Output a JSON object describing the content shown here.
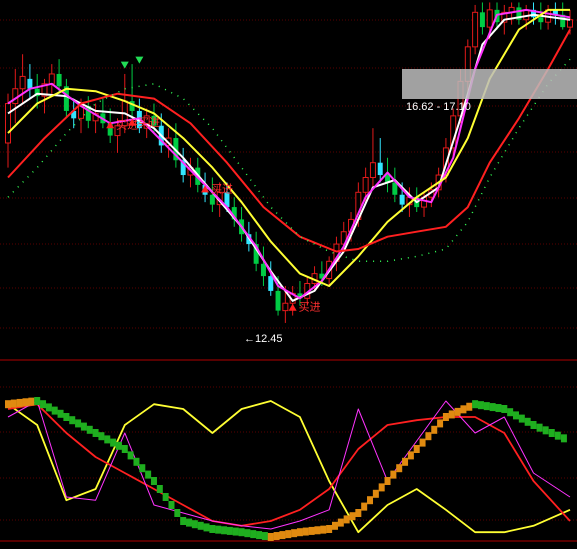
{
  "chart_data": [
    {
      "type": "candlestick",
      "panel": "price",
      "grid": true,
      "background": "#000000",
      "up_color": "#e31a1a",
      "down_color_strong": "#00cc44",
      "down_color_light": "#33e6ff",
      "ylim": [
        11.8,
        19.0
      ],
      "annotations": {
        "low_marker": "12.45",
        "range_box": "16.62 - 17.10",
        "signal_label": "买进"
      },
      "candles": [
        [
          16.1,
          17.1,
          15.6,
          16.9
        ],
        [
          16.9,
          17.6,
          16.5,
          17.2
        ],
        [
          17.2,
          17.9,
          16.9,
          17.45
        ],
        [
          17.4,
          17.7,
          17.0,
          17.2
        ],
        [
          17.2,
          17.5,
          16.8,
          17.05
        ],
        [
          17.05,
          17.4,
          16.7,
          17.3
        ],
        [
          17.3,
          17.7,
          17.1,
          17.5
        ],
        [
          17.5,
          17.8,
          17.1,
          17.25
        ],
        [
          17.25,
          17.4,
          16.6,
          16.75
        ],
        [
          16.75,
          17.0,
          16.4,
          16.6
        ],
        [
          16.6,
          17.0,
          16.3,
          16.85
        ],
        [
          16.85,
          17.05,
          16.4,
          16.55
        ],
        [
          16.55,
          16.9,
          16.3,
          16.7
        ],
        [
          16.7,
          17.0,
          16.4,
          16.5
        ],
        [
          16.5,
          16.8,
          16.1,
          16.25
        ],
        [
          16.25,
          16.6,
          15.9,
          16.45
        ],
        [
          16.45,
          17.5,
          16.3,
          16.95
        ],
        [
          16.95,
          17.7,
          16.6,
          16.75
        ],
        [
          16.75,
          17.0,
          16.3,
          16.4
        ],
        [
          16.4,
          16.8,
          16.2,
          16.65
        ],
        [
          16.65,
          16.9,
          16.3,
          16.45
        ],
        [
          16.45,
          16.7,
          15.9,
          16.05
        ],
        [
          16.05,
          16.4,
          15.8,
          16.2
        ],
        [
          16.2,
          16.5,
          15.6,
          15.75
        ],
        [
          15.75,
          16.0,
          15.3,
          15.45
        ],
        [
          15.45,
          15.8,
          15.2,
          15.6
        ],
        [
          15.6,
          15.8,
          15.1,
          15.25
        ],
        [
          15.25,
          15.5,
          14.9,
          15.05
        ],
        [
          15.05,
          15.4,
          14.7,
          14.85
        ],
        [
          14.85,
          15.3,
          14.6,
          15.1
        ],
        [
          15.1,
          15.3,
          14.7,
          14.8
        ],
        [
          14.8,
          15.0,
          14.4,
          14.55
        ],
        [
          14.55,
          14.8,
          14.1,
          14.25
        ],
        [
          14.25,
          14.5,
          13.9,
          14.05
        ],
        [
          14.05,
          14.3,
          13.5,
          13.65
        ],
        [
          13.65,
          14.0,
          13.2,
          13.4
        ],
        [
          13.4,
          13.7,
          13.0,
          13.1
        ],
        [
          13.1,
          13.4,
          12.6,
          12.7
        ],
        [
          12.7,
          13.2,
          12.45,
          12.85
        ],
        [
          12.85,
          13.2,
          12.6,
          13.05
        ],
        [
          13.05,
          13.3,
          12.8,
          12.95
        ],
        [
          12.95,
          13.4,
          12.8,
          13.25
        ],
        [
          13.25,
          13.6,
          13.1,
          13.45
        ],
        [
          13.45,
          13.7,
          13.2,
          13.35
        ],
        [
          13.35,
          13.8,
          13.2,
          13.7
        ],
        [
          13.7,
          14.2,
          13.5,
          14.05
        ],
        [
          14.05,
          14.5,
          13.9,
          14.3
        ],
        [
          14.3,
          14.7,
          14.1,
          14.55
        ],
        [
          14.55,
          15.3,
          14.4,
          15.1
        ],
        [
          15.1,
          15.6,
          14.9,
          15.4
        ],
        [
          15.4,
          16.4,
          15.2,
          15.7
        ],
        [
          15.7,
          16.2,
          15.3,
          15.45
        ],
        [
          15.45,
          15.8,
          15.1,
          15.3
        ],
        [
          15.3,
          15.6,
          14.9,
          15.05
        ],
        [
          15.05,
          15.3,
          14.7,
          14.85
        ],
        [
          14.85,
          15.2,
          14.6,
          15.0
        ],
        [
          15.0,
          15.2,
          14.7,
          14.8
        ],
        [
          14.8,
          15.1,
          14.6,
          15.0
        ],
        [
          15.0,
          15.3,
          14.8,
          15.15
        ],
        [
          15.15,
          15.6,
          15.0,
          15.45
        ],
        [
          15.45,
          16.2,
          15.3,
          16.0
        ],
        [
          16.0,
          16.8,
          15.8,
          16.65
        ],
        [
          16.65,
          17.6,
          16.5,
          17.35
        ],
        [
          17.35,
          18.2,
          17.1,
          18.05
        ],
        [
          18.05,
          18.9,
          17.9,
          18.75
        ],
        [
          18.75,
          18.95,
          18.3,
          18.45
        ],
        [
          18.45,
          18.95,
          18.2,
          18.8
        ],
        [
          18.8,
          18.95,
          18.4,
          18.55
        ],
        [
          18.55,
          18.9,
          18.3,
          18.75
        ],
        [
          18.75,
          18.95,
          18.5,
          18.85
        ],
        [
          18.85,
          18.95,
          18.5,
          18.6
        ],
        [
          18.6,
          18.9,
          18.4,
          18.8
        ],
        [
          18.8,
          18.95,
          18.5,
          18.65
        ],
        [
          18.65,
          18.95,
          18.4,
          18.55
        ],
        [
          18.55,
          18.9,
          18.4,
          18.8
        ],
        [
          18.8,
          18.95,
          18.5,
          18.7
        ],
        [
          18.7,
          18.95,
          18.4,
          18.45
        ],
        [
          18.45,
          18.8,
          18.3,
          18.6
        ]
      ],
      "series": [
        {
          "color": "#ffffff",
          "points": [
            [
              0,
              16.7
            ],
            [
              4,
              17.1
            ],
            [
              8,
              17.05
            ],
            [
              12,
              16.75
            ],
            [
              16,
              16.7
            ],
            [
              20,
              16.4
            ],
            [
              24,
              15.8
            ],
            [
              28,
              15.1
            ],
            [
              32,
              14.4
            ],
            [
              36,
              13.5
            ],
            [
              39,
              12.9
            ],
            [
              42,
              13.1
            ],
            [
              46,
              13.9
            ],
            [
              50,
              15.2
            ],
            [
              53,
              15.35
            ],
            [
              56,
              14.9
            ],
            [
              59,
              15.2
            ],
            [
              62,
              16.6
            ],
            [
              65,
              18.1
            ],
            [
              68,
              18.6
            ],
            [
              72,
              18.7
            ],
            [
              77,
              18.6
            ]
          ]
        },
        {
          "color": "#ff33ff",
          "points": [
            [
              0,
              16.9
            ],
            [
              3,
              17.2
            ],
            [
              6,
              17.3
            ],
            [
              10,
              16.85
            ],
            [
              14,
              16.5
            ],
            [
              18,
              16.6
            ],
            [
              22,
              16.0
            ],
            [
              26,
              15.4
            ],
            [
              30,
              14.8
            ],
            [
              34,
              14.0
            ],
            [
              37,
              13.2
            ],
            [
              40,
              12.95
            ],
            [
              43,
              13.3
            ],
            [
              46,
              14.0
            ],
            [
              49,
              15.0
            ],
            [
              52,
              15.5
            ],
            [
              55,
              15.0
            ],
            [
              58,
              14.9
            ],
            [
              61,
              15.8
            ],
            [
              64,
              17.6
            ],
            [
              67,
              18.7
            ],
            [
              71,
              18.8
            ],
            [
              77,
              18.65
            ]
          ]
        },
        {
          "color": "#ffff33",
          "points": [
            [
              0,
              16.3
            ],
            [
              4,
              16.9
            ],
            [
              8,
              17.2
            ],
            [
              12,
              17.15
            ],
            [
              16,
              16.95
            ],
            [
              20,
              16.7
            ],
            [
              24,
              16.2
            ],
            [
              28,
              15.6
            ],
            [
              32,
              14.9
            ],
            [
              36,
              14.1
            ],
            [
              40,
              13.45
            ],
            [
              44,
              13.2
            ],
            [
              48,
              13.8
            ],
            [
              52,
              14.5
            ],
            [
              56,
              15.0
            ],
            [
              60,
              15.4
            ],
            [
              63,
              16.2
            ],
            [
              66,
              17.4
            ],
            [
              70,
              18.4
            ],
            [
              74,
              18.8
            ],
            [
              77,
              18.8
            ]
          ]
        },
        {
          "color": "#ff2020",
          "points": [
            [
              0,
              15.4
            ],
            [
              5,
              16.2
            ],
            [
              10,
              16.9
            ],
            [
              15,
              17.1
            ],
            [
              20,
              17.0
            ],
            [
              25,
              16.5
            ],
            [
              30,
              15.7
            ],
            [
              35,
              14.8
            ],
            [
              40,
              14.2
            ],
            [
              45,
              13.9
            ],
            [
              48,
              13.95
            ],
            [
              52,
              14.2
            ],
            [
              56,
              14.3
            ],
            [
              60,
              14.4
            ],
            [
              63,
              14.8
            ],
            [
              66,
              15.7
            ],
            [
              70,
              16.6
            ],
            [
              74,
              17.6
            ],
            [
              77,
              18.4
            ]
          ]
        },
        {
          "color": "#33ff55",
          "dotted": true,
          "points": [
            [
              0,
              15.0
            ],
            [
              4,
              15.6
            ],
            [
              8,
              16.3
            ],
            [
              12,
              16.9
            ],
            [
              16,
              17.2
            ],
            [
              20,
              17.3
            ],
            [
              24,
              17.0
            ],
            [
              28,
              16.4
            ],
            [
              32,
              15.6
            ],
            [
              36,
              14.8
            ],
            [
              40,
              14.2
            ],
            [
              44,
              13.9
            ],
            [
              48,
              13.7
            ],
            [
              52,
              13.7
            ],
            [
              56,
              13.8
            ],
            [
              60,
              13.95
            ],
            [
              63,
              14.5
            ],
            [
              66,
              15.4
            ],
            [
              70,
              16.4
            ],
            [
              74,
              17.3
            ],
            [
              77,
              17.8
            ]
          ]
        }
      ],
      "signals": [
        {
          "type": "sell",
          "i": 16,
          "price": 17.65
        },
        {
          "type": "sell",
          "i": 18,
          "price": 17.75
        },
        {
          "type": "buy",
          "i": 14,
          "price": 16.5
        },
        {
          "type": "buy",
          "i": 17,
          "price": 16.55
        },
        {
          "type": "buy",
          "i": 27,
          "price": 15.2
        },
        {
          "type": "buy",
          "i": 39,
          "price": 12.8
        }
      ]
    },
    {
      "type": "line",
      "panel": "indicator",
      "ylim": [
        0,
        100
      ],
      "x": [
        0,
        4,
        8,
        12,
        16,
        20,
        24,
        28,
        32,
        36,
        40,
        44,
        48,
        52,
        56,
        60,
        64,
        68,
        72,
        77
      ],
      "series": [
        {
          "color": "#ffff33",
          "values": [
            88,
            75,
            28,
            35,
            75,
            88,
            85,
            70,
            85,
            90,
            80,
            40,
            8,
            25,
            35,
            22,
            8,
            8,
            12,
            22
          ]
        },
        {
          "color": "#ff2020",
          "values": [
            85,
            88,
            70,
            55,
            45,
            35,
            25,
            15,
            12,
            15,
            22,
            35,
            60,
            75,
            78,
            80,
            80,
            70,
            40,
            15
          ]
        },
        {
          "color": "#ff33ff",
          "values": [
            80,
            90,
            30,
            28,
            70,
            25,
            20,
            15,
            12,
            10,
            15,
            22,
            85,
            40,
            65,
            90,
            70,
            80,
            45,
            30
          ]
        },
        {
          "color": "#22cc22",
          "style": "block",
          "values": [
            88,
            90,
            80,
            70,
            60,
            40,
            15,
            10,
            8,
            5,
            8,
            10,
            20,
            40,
            60,
            80,
            88,
            85,
            75,
            65
          ]
        }
      ]
    }
  ]
}
